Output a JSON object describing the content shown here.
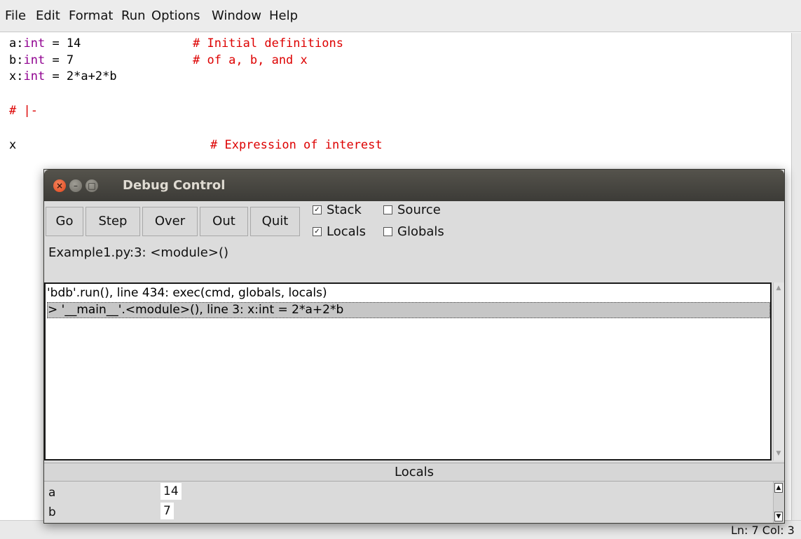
{
  "menu": {
    "file": "File",
    "edit": "Edit",
    "format": "Format",
    "run": "Run",
    "options": "Options",
    "window": "Window",
    "help": "Help"
  },
  "code": {
    "line1_var": "a:",
    "line1_type": "int",
    "line1_rest": " = 14",
    "line1_comment": "# Initial definitions",
    "line2_var": "b:",
    "line2_type": "int",
    "line2_rest": " = 7",
    "line2_comment": "# of a, b, and x",
    "line3_var": "x:",
    "line3_type": "int",
    "line3_rest": " = 2*a+2*b",
    "line4_comment": "# |-",
    "line5_text": "x",
    "line5_comment": "# Expression of interest"
  },
  "statusbar": {
    "position": "Ln: 7  Col: 3"
  },
  "debug": {
    "title": "Debug Control",
    "buttons": {
      "go": "Go",
      "step": "Step",
      "over": "Over",
      "out": "Out",
      "quit": "Quit"
    },
    "options": {
      "stack": "Stack",
      "source": "Source",
      "locals": "Locals",
      "globals": "Globals"
    },
    "status": "Example1.py:3: <module>()",
    "stack": [
      "'bdb'.run(), line 434: exec(cmd, globals, locals)",
      "> '__main__'.<module>(), line 3: x:int = 2*a+2*b"
    ],
    "locals_header": "Locals",
    "locals": [
      {
        "name": "a",
        "value": "14"
      },
      {
        "name": "b",
        "value": "7"
      }
    ]
  }
}
